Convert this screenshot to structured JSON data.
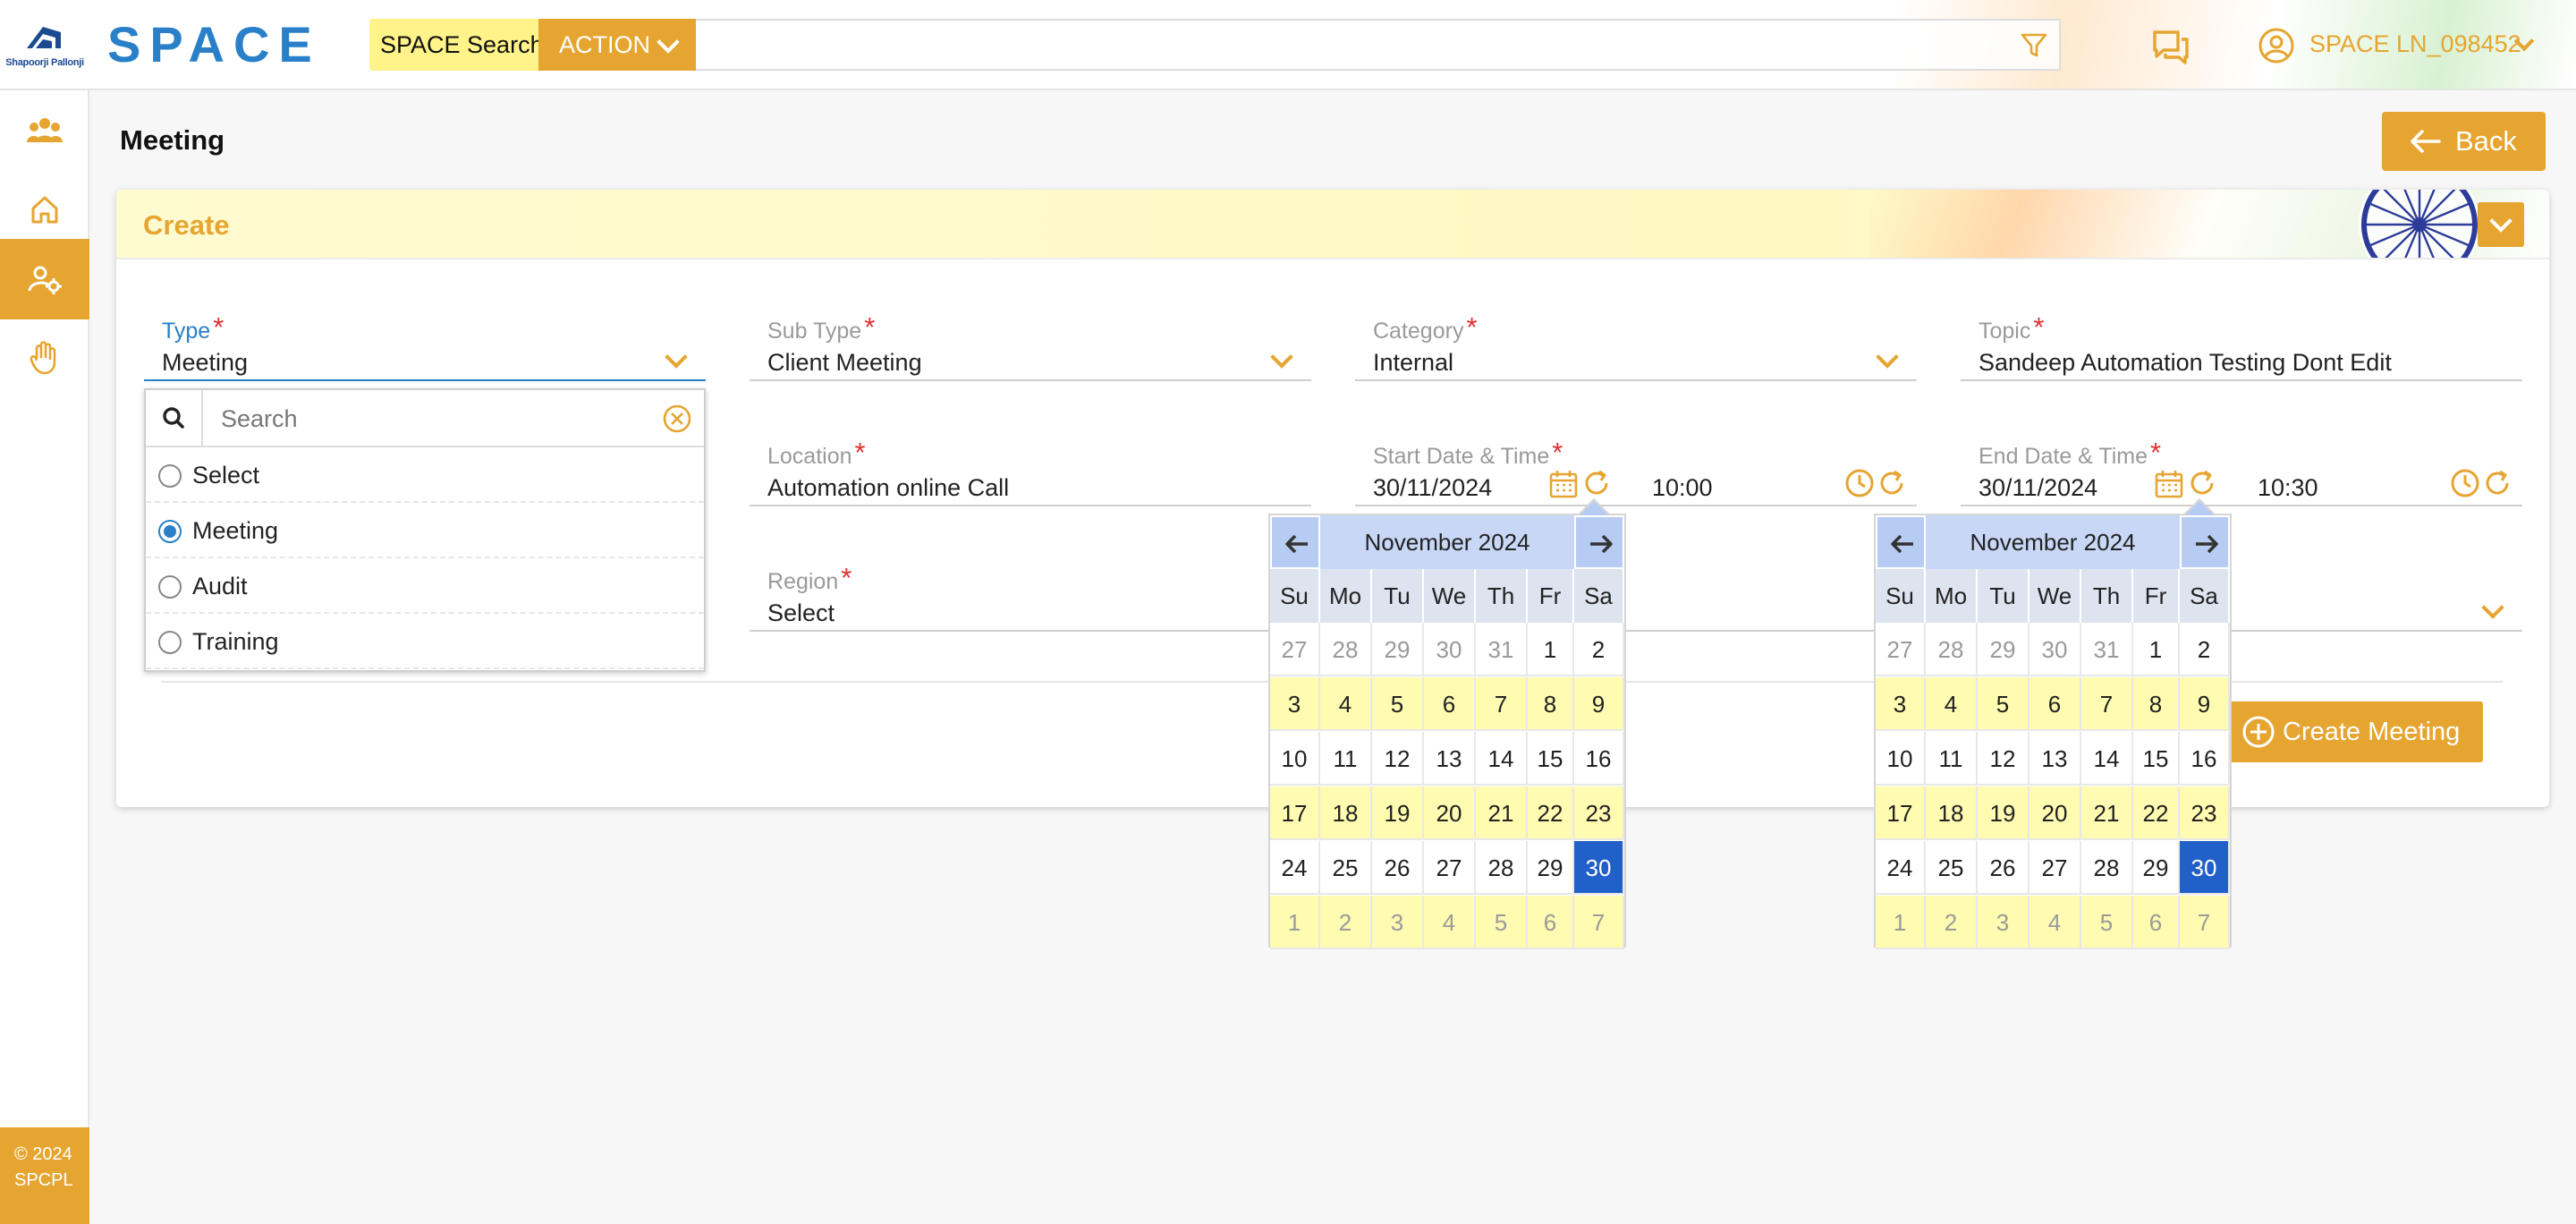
{
  "header": {
    "company_logo_text": "Shapoorji Pallonji",
    "brand": "SPACE",
    "search_label": "SPACE Search",
    "action_label": "ACTION",
    "search_value": "",
    "user_name": "SPACE LN_098452"
  },
  "sidebar": {
    "items": [
      {
        "icon": "users-icon",
        "active": false
      },
      {
        "icon": "home-icon",
        "active": false
      },
      {
        "icon": "user-settings-icon",
        "active": true
      },
      {
        "icon": "hand-icon",
        "active": false
      }
    ],
    "copyright_line1": "© 2024",
    "copyright_line2": "SPCPL"
  },
  "page": {
    "title": "Meeting",
    "back_label": "Back"
  },
  "card": {
    "title": "Create",
    "create_label": "Create Meeting"
  },
  "form": {
    "type": {
      "label": "Type",
      "value": "Meeting"
    },
    "sub_type": {
      "label": "Sub Type",
      "value": "Client Meeting"
    },
    "category": {
      "label": "Category",
      "value": "Internal"
    },
    "topic": {
      "label": "Topic",
      "value": "Sandeep Automation Testing Dont Edit"
    },
    "location": {
      "label": "Location",
      "value": "Automation online Call"
    },
    "start": {
      "label": "Start Date & Time",
      "date": "30/11/2024",
      "time": "10:00"
    },
    "end": {
      "label": "End Date & Time",
      "date": "30/11/2024",
      "time": "10:30"
    },
    "region": {
      "label": "Region",
      "value": "Select"
    }
  },
  "type_dropdown": {
    "search_placeholder": "Search",
    "options": [
      {
        "label": "Select",
        "selected": false
      },
      {
        "label": "Meeting",
        "selected": true
      },
      {
        "label": "Audit",
        "selected": false
      },
      {
        "label": "Training",
        "selected": false
      }
    ]
  },
  "calendar": {
    "month_label": "November 2024",
    "weekdays": [
      "Su",
      "Mo",
      "Tu",
      "We",
      "Th",
      "Fr",
      "Sa"
    ],
    "weeks": [
      [
        "27",
        "28",
        "29",
        "30",
        "31",
        "1",
        "2"
      ],
      [
        "3",
        "4",
        "5",
        "6",
        "7",
        "8",
        "9"
      ],
      [
        "10",
        "11",
        "12",
        "13",
        "14",
        "15",
        "16"
      ],
      [
        "17",
        "18",
        "19",
        "20",
        "21",
        "22",
        "23"
      ],
      [
        "24",
        "25",
        "26",
        "27",
        "28",
        "29",
        "30"
      ],
      [
        "1",
        "2",
        "3",
        "4",
        "5",
        "6",
        "7"
      ]
    ],
    "selected_day": "30"
  },
  "colors": {
    "accent": "#e6a531",
    "brand_blue": "#2a80c8",
    "selected_day": "#2160c8"
  }
}
